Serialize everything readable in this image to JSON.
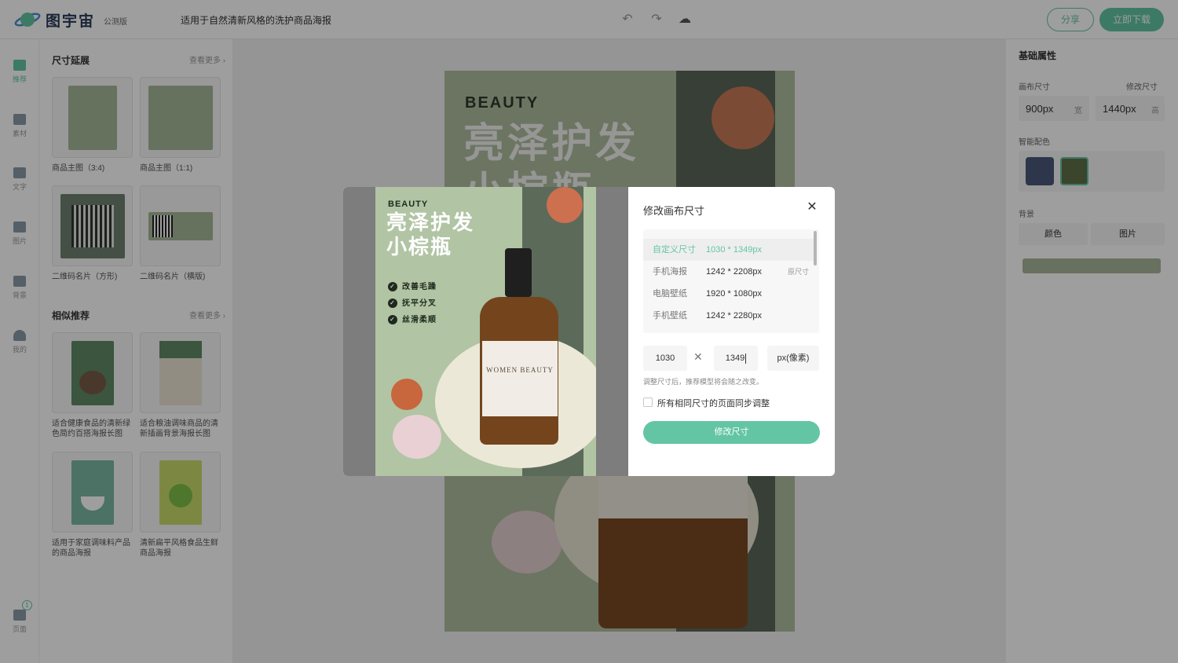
{
  "header": {
    "logo_text": "图宇宙",
    "beta_label": "公测版",
    "doc_title": "适用于自然清新风格的洗护商品海报",
    "undo_icon": "undo-icon",
    "redo_icon": "redo-icon",
    "cloud_icon": "cloud-save-icon",
    "share_label": "分享",
    "download_label": "立即下载"
  },
  "rail": {
    "items": [
      {
        "label": "推荐",
        "icon": "recommend-icon"
      },
      {
        "label": "素材",
        "icon": "shapes-icon"
      },
      {
        "label": "文字",
        "icon": "text-icon"
      },
      {
        "label": "图片",
        "icon": "image-icon"
      },
      {
        "label": "背景",
        "icon": "background-icon"
      },
      {
        "label": "我的",
        "icon": "user-icon"
      }
    ],
    "pages_label": "页面",
    "pages_badge": "1"
  },
  "left_panel": {
    "size_section": {
      "title": "尺寸延展",
      "more": "查看更多",
      "items": [
        {
          "caption": "商品主图（3:4)"
        },
        {
          "caption": "商品主图（1:1)"
        },
        {
          "caption": "二维码名片（方形)"
        },
        {
          "caption": "二维码名片（横版)"
        }
      ]
    },
    "similar_section": {
      "title": "相似推荐",
      "more": "查看更多",
      "items": [
        {
          "caption": "适合健康食品的清新绿色简约百搭海报长图"
        },
        {
          "caption": "适合粮油调味商品的清新插画背景海报长图"
        },
        {
          "caption": "适用于家庭调味料产品的商品海报"
        },
        {
          "caption": "清新扁平风格食品生鲜商品海报"
        }
      ]
    }
  },
  "poster": {
    "brand": "BEAUTY",
    "headline_line1": "亮泽护发",
    "headline_line2": "小棕瓶"
  },
  "right_panel": {
    "title": "基础属性",
    "canvas_size_label": "画布尺寸",
    "modify_size_label": "修改尺寸",
    "width_value": "900px",
    "width_unit": "宽",
    "height_value": "1440px",
    "height_unit": "高",
    "smart_color_label": "智能配色",
    "swatches": [
      "#4a5878",
      "#5f7048"
    ],
    "background_label": "背景",
    "bg_tab_color": "颜色",
    "bg_tab_image": "图片",
    "bg_color": "#a8b79a"
  },
  "modal": {
    "title": "修改画布尺寸",
    "preview": {
      "brand": "BEAUTY",
      "headline_line1": "亮泽护发",
      "headline_line2": "小棕瓶",
      "checks": [
        "改善毛躁",
        "抚平分叉",
        "丝滑柔顺"
      ],
      "bottle_brand": "WOMEN BEAUTY"
    },
    "presets": [
      {
        "name": "自定义尺寸",
        "value": "1030 * 1349px",
        "tag": ""
      },
      {
        "name": "手机海报",
        "value": "1242 * 2208px",
        "tag": "原尺寸"
      },
      {
        "name": "电脑壁纸",
        "value": "1920 * 1080px",
        "tag": ""
      },
      {
        "name": "手机壁纸",
        "value": "1242 * 2280px",
        "tag": ""
      }
    ],
    "width_input": "1030",
    "height_input": "1349",
    "unit": "px(像素)",
    "hint": "调整尺寸后，推荐模型将会随之改变。",
    "sync_label": "所有相同尺寸的页面同步调整",
    "submit_label": "修改尺寸"
  }
}
